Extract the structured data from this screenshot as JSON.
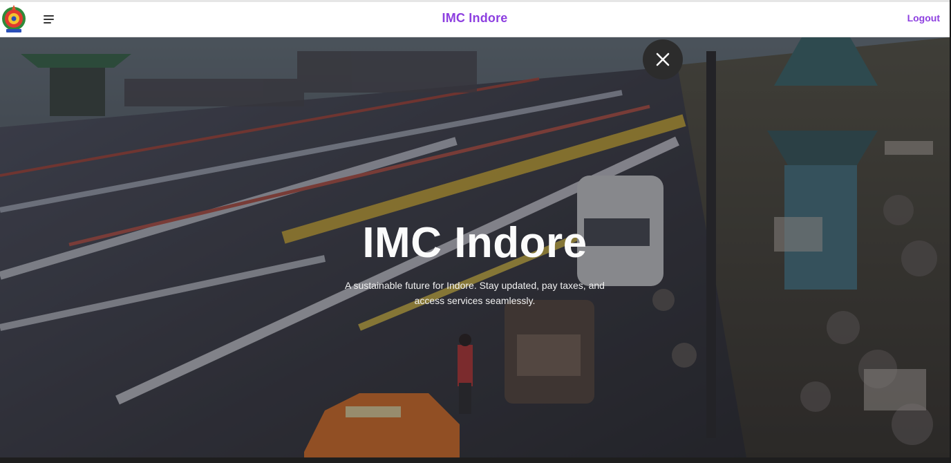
{
  "header": {
    "logo_icon": "imc-emblem-icon",
    "menu_icon": "hamburger-menu-icon",
    "title": "IMC Indore",
    "logout_label": "Logout"
  },
  "hero": {
    "title": "IMC Indore",
    "subtitle": "A sustainable future for Indore. Stay updated, pay taxes, and access services seamlessly.",
    "close_icon": "close-icon",
    "background": "city-street-traffic-photo"
  },
  "colors": {
    "brand": "#8d3fe0",
    "header_bg": "#ffffff",
    "hero_text": "#fbfbfb"
  }
}
